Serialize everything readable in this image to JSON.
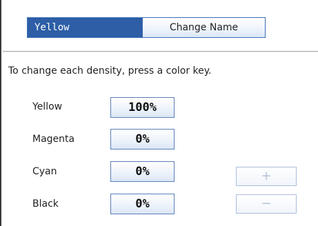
{
  "header": {
    "current_name": "Yellow",
    "change_name_label": "Change Name"
  },
  "instruction": "To change each density, press a color key.",
  "densities": [
    {
      "label": "Yellow",
      "value": "100%"
    },
    {
      "label": "Magenta",
      "value": "0%"
    },
    {
      "label": "Cyan",
      "value": "0%"
    },
    {
      "label": "Black",
      "value": "0%"
    }
  ],
  "adjust": {
    "plus_label": "+",
    "minus_label": "−"
  }
}
